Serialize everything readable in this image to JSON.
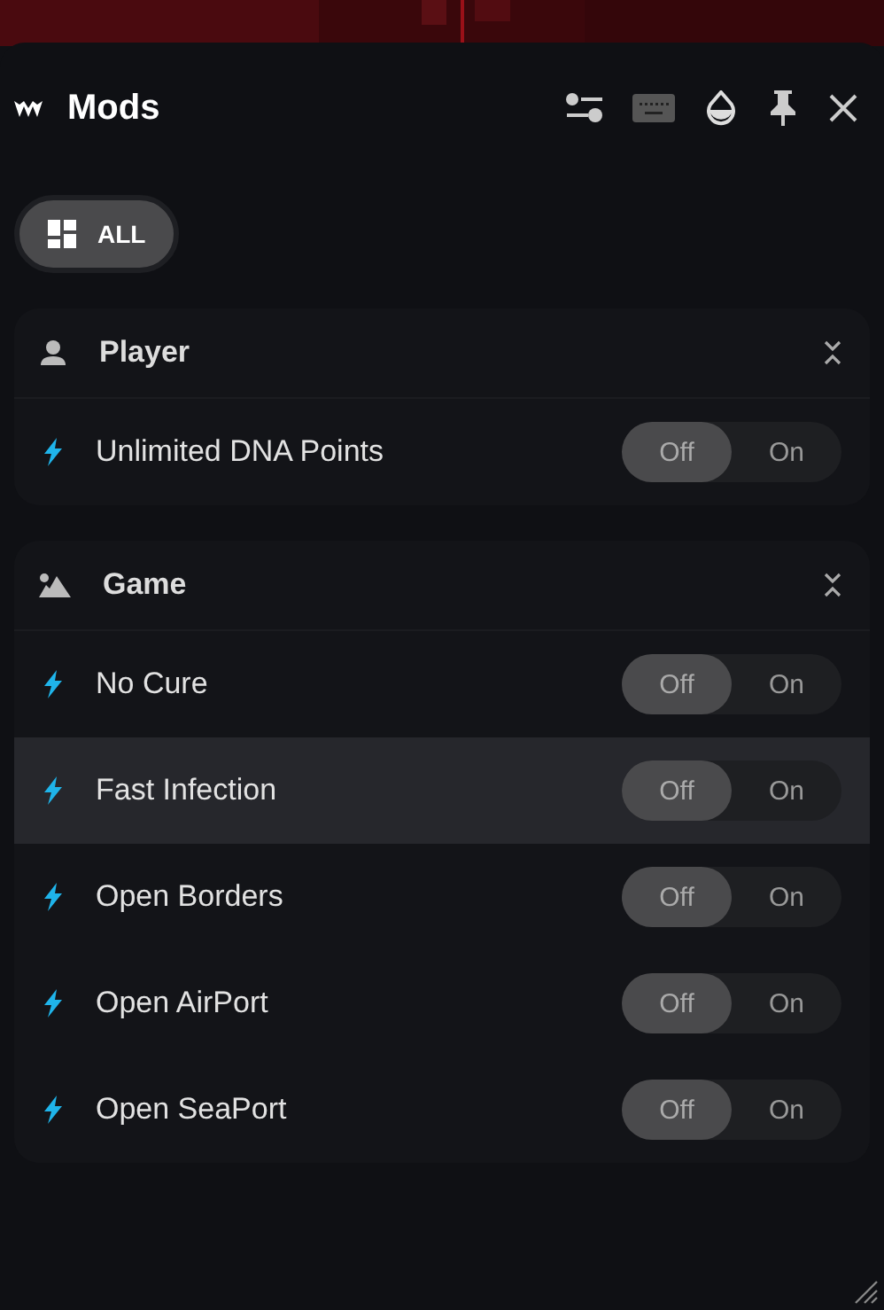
{
  "header": {
    "title": "Mods"
  },
  "filters": [
    {
      "label": "ALL",
      "selected": true
    }
  ],
  "sections": [
    {
      "title": "Player",
      "mods": [
        {
          "name": "Unlimited DNA Points",
          "highlighted": false,
          "options": [
            {
              "label": "Off",
              "selected": true
            },
            {
              "label": "On",
              "selected": false
            }
          ]
        }
      ]
    },
    {
      "title": "Game",
      "mods": [
        {
          "name": "No Cure",
          "highlighted": false,
          "options": [
            {
              "label": "Off",
              "selected": true
            },
            {
              "label": "On",
              "selected": false
            }
          ]
        },
        {
          "name": "Fast Infection",
          "highlighted": true,
          "options": [
            {
              "label": "Off",
              "selected": true
            },
            {
              "label": "On",
              "selected": false
            }
          ]
        },
        {
          "name": "Open Borders",
          "highlighted": false,
          "options": [
            {
              "label": "Off",
              "selected": true
            },
            {
              "label": "On",
              "selected": false
            }
          ]
        },
        {
          "name": "Open AirPort",
          "highlighted": false,
          "options": [
            {
              "label": "Off",
              "selected": true
            },
            {
              "label": "On",
              "selected": false
            }
          ]
        },
        {
          "name": "Open SeaPort",
          "highlighted": false,
          "options": [
            {
              "label": "Off",
              "selected": true
            },
            {
              "label": "On",
              "selected": false
            }
          ]
        }
      ]
    }
  ]
}
